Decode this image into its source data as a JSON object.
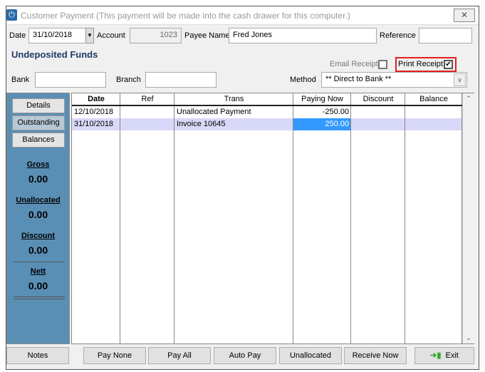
{
  "window": {
    "title": "Customer Payment (This payment will be made into the cash drawer for this computer.)",
    "close_label": "✕"
  },
  "form": {
    "date_label": "Date",
    "date_value": "31/10/2018",
    "account_label": "Account",
    "account_value": "1023",
    "payee_label": "Payee Name",
    "payee_value": "Fred Jones",
    "reference_label": "Reference",
    "reference_value": "",
    "section_title": "Undeposited Funds",
    "email_receipt_label": "Email Receipt",
    "email_receipt_checked": false,
    "print_receipt_label": "Print Receipt",
    "print_receipt_checked": true,
    "bank_label": "Bank",
    "bank_value": "",
    "branch_label": "Branch",
    "branch_value": "",
    "method_label": "Method",
    "method_value": "** Direct to Bank **"
  },
  "side": {
    "buttons": [
      "Details",
      "Outstanding",
      "Balances"
    ],
    "stats": [
      {
        "label": "Gross",
        "value": "0.00"
      },
      {
        "label": "Unallocated",
        "value": "0.00"
      },
      {
        "label": "Discount",
        "value": "0.00"
      },
      {
        "label": "Nett",
        "value": "0.00"
      }
    ]
  },
  "table": {
    "columns": [
      "Date",
      "Ref",
      "Trans",
      "Paying Now",
      "Discount",
      "Balance"
    ],
    "rows": [
      [
        "12/10/2018",
        "",
        "Unallocated Payment",
        "-250.00",
        "",
        ""
      ],
      [
        "31/10/2018",
        "",
        "Invoice 10645",
        "250.00",
        "",
        ""
      ]
    ]
  },
  "footer": {
    "notes": "Notes",
    "pay_none": "Pay None",
    "pay_all": "Pay All",
    "auto_pay": "Auto Pay",
    "unallocated": "Unallocated",
    "receive_now": "Receive Now",
    "exit": "Exit"
  },
  "colors": {
    "panel": "#5a8fb5",
    "selected_row": "#d8d8f8",
    "selected_cell": "#3399ff",
    "highlight_border": "#e02020"
  }
}
